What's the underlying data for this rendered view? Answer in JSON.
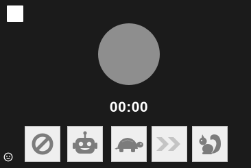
{
  "recorder": {
    "timer": "00:00",
    "status": "idle"
  },
  "controls": {
    "stop_icon": "stop-square-icon",
    "record_icon": "record-circle-icon"
  },
  "effects": [
    {
      "id": "none",
      "icon": "no-effect-icon",
      "selected": false
    },
    {
      "id": "robot",
      "icon": "robot-icon",
      "selected": false
    },
    {
      "id": "slow",
      "icon": "turtle-icon",
      "selected": false
    },
    {
      "id": "fast",
      "icon": "fast-forward-icon",
      "selected": false
    },
    {
      "id": "squirrel",
      "icon": "squirrel-icon",
      "selected": false
    }
  ],
  "colors": {
    "background": "#1b1b1b",
    "record_button": "#8e8e8e",
    "effect_tile": "#efefef",
    "effect_icon": "#7c7c7c",
    "fast_icon": "#c4c4c4",
    "text": "#ffffff"
  }
}
